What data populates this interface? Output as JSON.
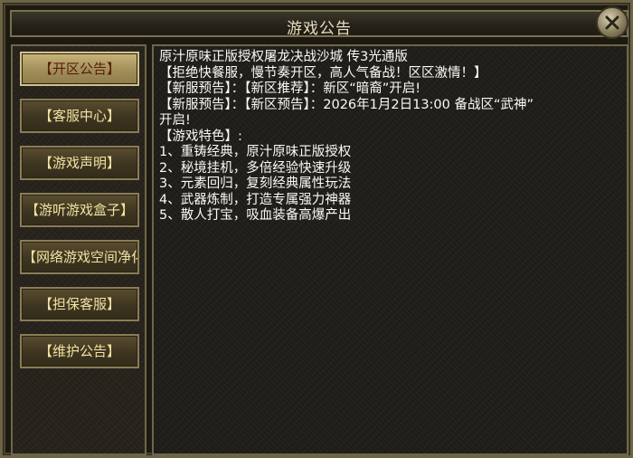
{
  "window": {
    "title": "游戏公告",
    "close_icon": "close-icon"
  },
  "menu": [
    {
      "label": "【开区公告】",
      "active": true
    },
    {
      "label": "【客服中心】",
      "active": false
    },
    {
      "label": "【游戏声明】",
      "active": false
    },
    {
      "label": "【游听游戏盒子】",
      "active": false
    },
    {
      "label": "【网络游戏空间净化",
      "active": false
    },
    {
      "label": "【担保客服】",
      "active": false
    },
    {
      "label": "【维护公告】",
      "active": false
    }
  ],
  "content": {
    "lines": [
      "原汁原味正版授权屠龙决战沙城 传3光通版",
      "【拒绝快餐服，慢节奏开区，高人气备战！区区激情！】",
      "【新服预告】：【新区推荐】：新区“暗裔”开启!",
      "【新服预告】：【新区预告】：2026年1月2日13:00 备战区“武神”",
      "开启!",
      "【游戏特色】:",
      "1、重铸经典，原汁原味正版授权",
      "2、秘境挂机，多倍经验快速升级",
      "3、元素回归，复刻经典属性玩法",
      "4、武器炼制，打造专属强力神器",
      "5、散人打宝，吸血装备高爆产出"
    ]
  },
  "colors": {
    "menu_text": "#f3e2a0",
    "menu_active_text": "#5a1e08",
    "content_text": "#ffffff",
    "frame": "#6f6548"
  }
}
